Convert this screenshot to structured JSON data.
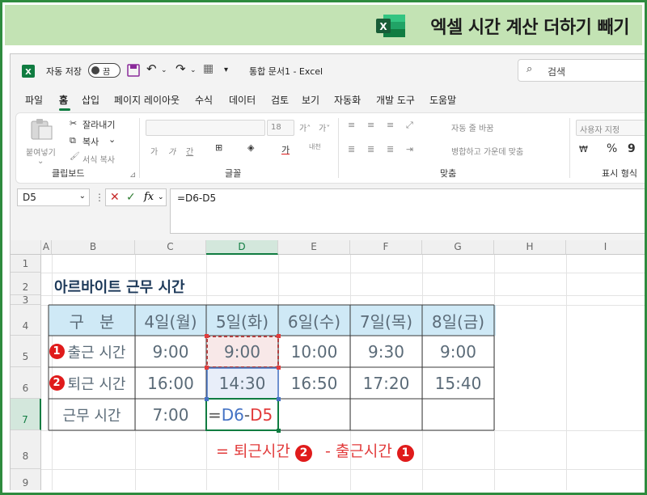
{
  "banner": {
    "title": "엑셀 시간 계산 더하기 빼기",
    "logo_letter": "X"
  },
  "titlebar": {
    "autosave": "자동 저장",
    "toggle": "끔",
    "doc_title": "통합 문서1  -  Excel",
    "search_placeholder": "검색"
  },
  "menu": {
    "items": [
      "파일",
      "홈",
      "삽입",
      "페이지 레이아웃",
      "수식",
      "데이터",
      "검토",
      "보기",
      "자동화",
      "개발 도구",
      "도움말"
    ],
    "active": "홈"
  },
  "ribbon": {
    "paste": "붙여넣기",
    "cut": "잘라내기",
    "copy": "복사",
    "format_painter": "서식 복사",
    "clipboard": "클립보드",
    "font_size": "18",
    "font_group": "글꼴",
    "bold": "가",
    "italic": "가",
    "underline": "간",
    "font_color": "가",
    "phonetic": "내천",
    "wrap": "자동 줄 바꿈",
    "merge": "병합하고 가운데 맞춤",
    "align_group": "맞춤",
    "number_format": "사용자 지정",
    "percent": "%",
    "comma": "9",
    "number_group": "표시 형식"
  },
  "formula_bar": {
    "name_box": "D5",
    "fx": "fx",
    "formula": "=D6-D5"
  },
  "sheet": {
    "columns": [
      "A",
      "B",
      "C",
      "D",
      "E",
      "F",
      "G",
      "H",
      "I"
    ],
    "rows": [
      "1",
      "2",
      "3",
      "4",
      "5",
      "6",
      "7",
      "8",
      "9"
    ],
    "title": "아르바이트 근무 시간",
    "header_label": "구   분",
    "days": [
      "4일(월)",
      "5일(화)",
      "6일(수)",
      "7일(목)",
      "8일(금)"
    ],
    "row_labels": [
      "출근 시간",
      "퇴근 시간",
      "근무 시간"
    ],
    "row_badges": [
      "1",
      "2"
    ],
    "start_times": [
      "9:00",
      "9:00",
      "10:00",
      "9:30",
      "9:00"
    ],
    "end_times": [
      "16:00",
      "14:30",
      "16:50",
      "17:20",
      "15:40"
    ],
    "work_times": [
      "7:00"
    ],
    "active_formula": {
      "eq": "=",
      "ref1": "D6",
      "minus": "-",
      "ref2": "D5"
    }
  },
  "annotation": {
    "prefix": "= 퇴근시간",
    "badge2": "2",
    "middle": " - 출근시간",
    "badge1": "1"
  },
  "colors": {
    "accent": "#107c41",
    "header_fill": "#cfe9f6",
    "ref_blue": "#4472c4",
    "ref_red": "#e23b3b",
    "banner_bg": "#c3e3b4",
    "frame": "#2e8b3e"
  }
}
